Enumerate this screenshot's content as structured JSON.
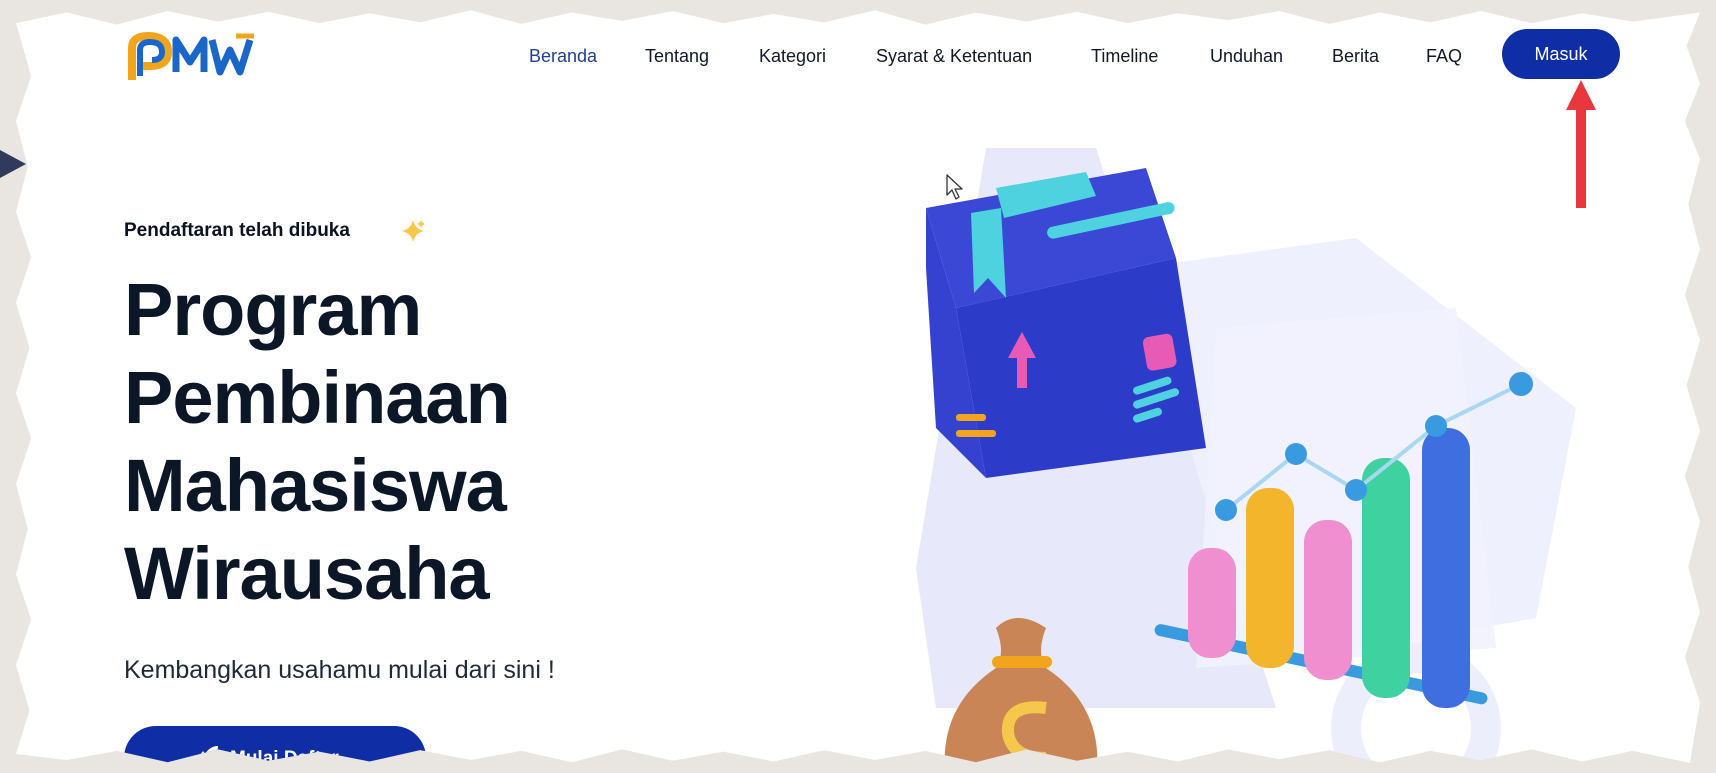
{
  "brand": {
    "logo_text": "PMW"
  },
  "nav": {
    "items": [
      {
        "label": "Beranda",
        "active": true
      },
      {
        "label": "Tentang"
      },
      {
        "label": "Kategori"
      },
      {
        "label": "Syarat & Ketentuan"
      },
      {
        "label": "Timeline"
      },
      {
        "label": "Unduhan"
      },
      {
        "label": "Berita"
      },
      {
        "label": "FAQ"
      }
    ],
    "login_label": "Masuk"
  },
  "hero": {
    "badge": "Pendaftaran telah dibuka",
    "title_lines": [
      "Program",
      "Pembinaan",
      "Mahasiswa",
      "Wirausaha"
    ],
    "subtitle": "Kembangkan usahamu mulai dari sini !",
    "cta_label": "Mulai Daftar"
  },
  "colors": {
    "primary": "#0f2ea5",
    "text_dark": "#0b1626",
    "active_nav": "#1f3f8f",
    "annotation_arrow": "#e8383d"
  },
  "icons": [
    "sparkle-icon",
    "rocket-icon",
    "mouse-cursor-icon",
    "red-arrow-annotation"
  ]
}
